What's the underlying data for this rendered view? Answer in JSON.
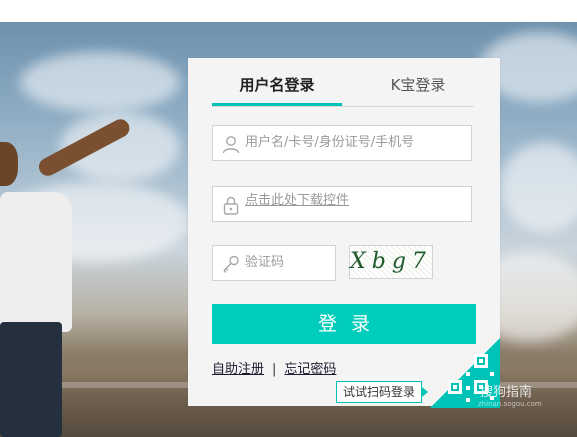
{
  "tabs": {
    "username_login": "用户名登录",
    "k_token_login": "K宝登录"
  },
  "form": {
    "username_placeholder": "用户名/卡号/身份证号/手机号",
    "download_control_link": "点击此处下载控件",
    "captcha_placeholder": "验证码",
    "captcha_text": "Xbg7",
    "login_button": "登录"
  },
  "links": {
    "register": "自助注册",
    "separator": "|",
    "forgot_password": "忘记密码"
  },
  "qr": {
    "tip": "试试扫码登录"
  },
  "watermark": {
    "text": "搜狗指南",
    "url": "zhinan.sogou.com"
  },
  "colors": {
    "accent": "#00cdbb",
    "link_warning": "#e8a500"
  },
  "icons": {
    "user": "user-icon",
    "lock": "lock-icon",
    "key": "key-icon",
    "qr": "qr-code-icon"
  }
}
